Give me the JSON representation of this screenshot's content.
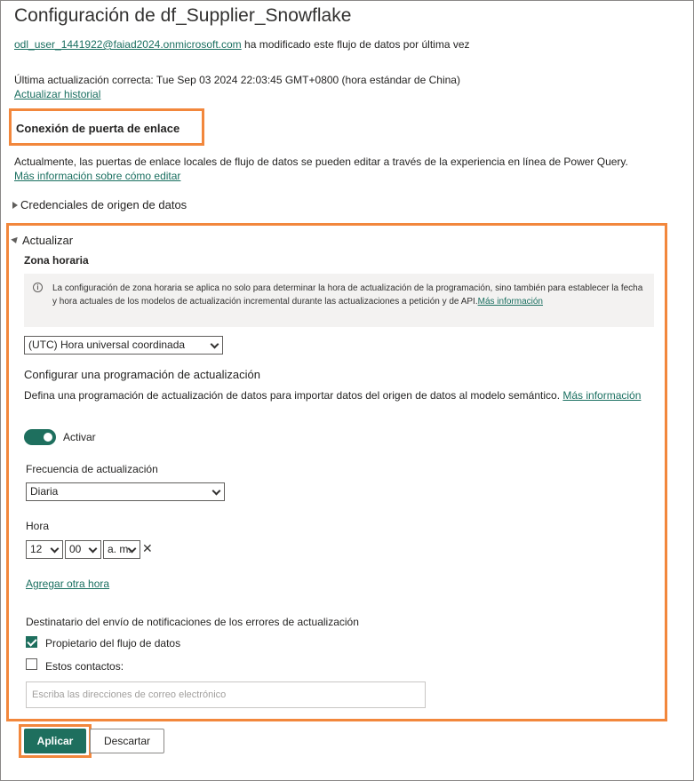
{
  "page": {
    "title": "Configuración de df_Supplier_Snowflake",
    "modified_by_email": "odl_user_1441922@faiad2024.onmicrosoft.com",
    "modified_by_text": " ha modificado este flujo de datos por última vez",
    "last_refresh": "Última actualización correcta: Tue Sep 03 2024 22:03:45 GMT+0800 (hora estándar de China)",
    "refresh_history_link": "Actualizar historial"
  },
  "gateway": {
    "title": "Conexión de puerta de enlace",
    "description": "Actualmente, las puertas de enlace locales de flujo de datos se pueden editar a través de la experiencia en línea de Power Query.",
    "learn_more_link": "Más información sobre cómo editar"
  },
  "credentials": {
    "label": "Credenciales de origen de datos"
  },
  "refresh": {
    "section_label": "Actualizar",
    "timezone_label": "Zona horaria",
    "timezone_info": "La configuración de zona horaria se aplica no solo para determinar la hora de actualización de la programación, sino también para establecer la fecha y hora actuales de los modelos de actualización incremental durante las actualizaciones a petición y de API.",
    "timezone_info_link": "Más información",
    "timezone_value": "(UTC) Hora universal coordinada",
    "schedule_title": "Configurar una programación de actualización",
    "schedule_desc": "Defina una programación de actualización de datos para importar datos del origen de datos al modelo semántico.",
    "schedule_desc_link": "Más información",
    "toggle_label": "Activar",
    "toggle_on": true,
    "frequency_label": "Frecuencia de actualización",
    "frequency_value": "Diaria",
    "time_label": "Hora",
    "hour_value": "12",
    "minute_value": "00",
    "ampm_value": "a. m.",
    "remove_time_glyph": "✕",
    "add_time_link": "Agregar otra hora",
    "notify_title": "Destinatario del envío de notificaciones de los errores de actualización",
    "notify_owner_label": "Propietario del flujo de datos",
    "notify_owner_checked": true,
    "notify_contacts_label": "Estos contactos:",
    "notify_contacts_checked": false,
    "email_placeholder": "Escriba las direcciones de correo electrónico"
  },
  "actions": {
    "apply_label": "Aplicar",
    "discard_label": "Descartar"
  },
  "colors": {
    "accent": "#1e6f5e",
    "highlight": "#f2873c"
  }
}
